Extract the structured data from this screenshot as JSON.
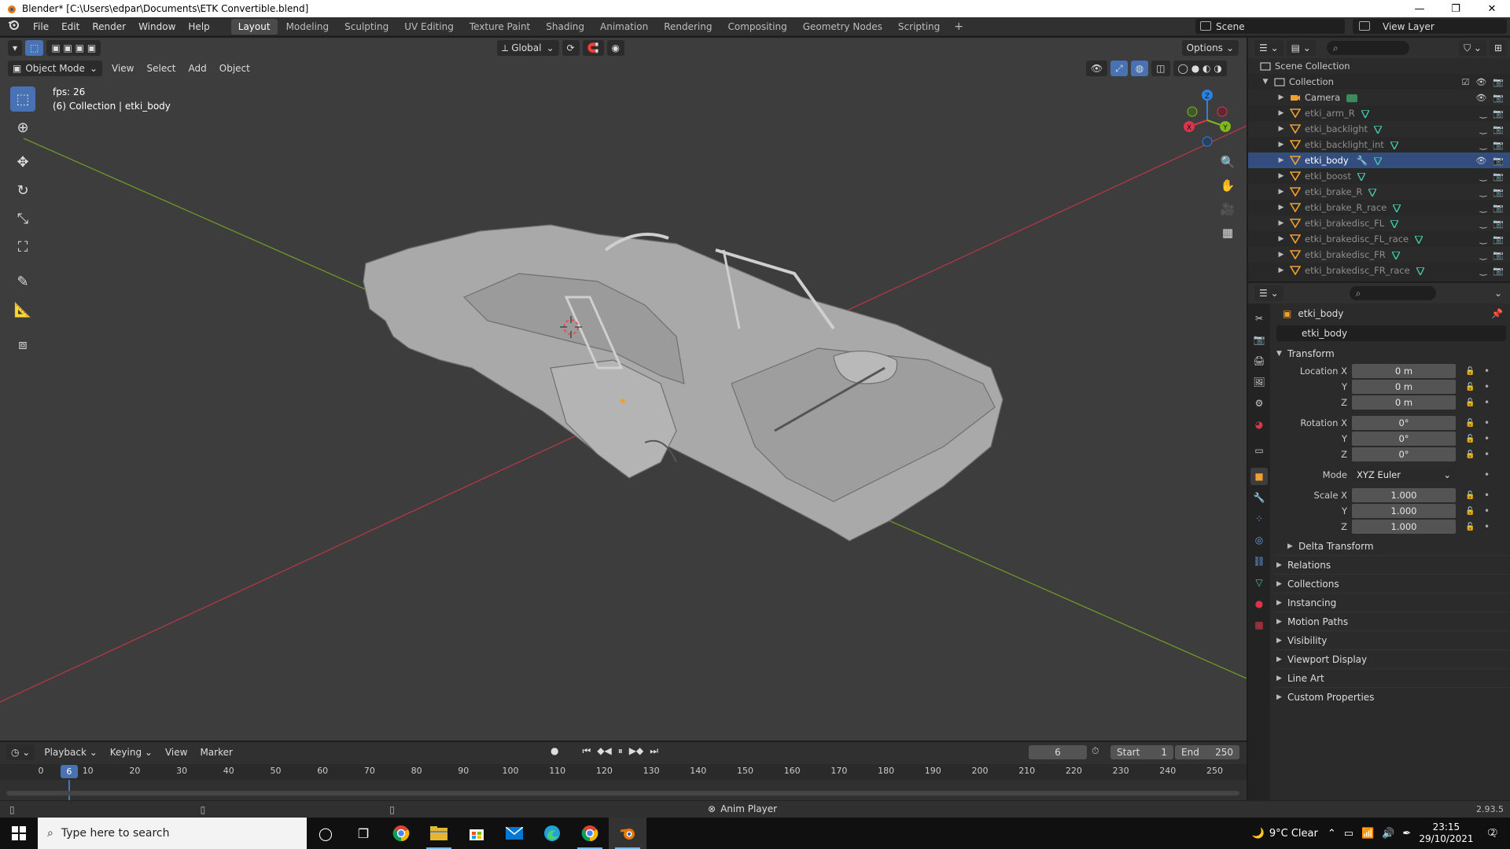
{
  "titlebar": {
    "title": "Blender* [C:\\Users\\edpar\\Documents\\ETK Convertible.blend]",
    "minimize": "—",
    "maximize": "❐",
    "close": "✕"
  },
  "menu": [
    "File",
    "Edit",
    "Render",
    "Window",
    "Help"
  ],
  "workspaces": [
    "Layout",
    "Modeling",
    "Sculpting",
    "UV Editing",
    "Texture Paint",
    "Shading",
    "Animation",
    "Rendering",
    "Compositing",
    "Geometry Nodes",
    "Scripting"
  ],
  "add_tab": "+",
  "scene": "Scene",
  "view_layer": "View Layer",
  "viewport": {
    "transform_orientation": "Global",
    "options": "Options",
    "mode": "Object Mode",
    "menus": [
      "View",
      "Select",
      "Add",
      "Object"
    ],
    "fps": "fps: 26",
    "collection_info": "(6) Collection | etki_body",
    "gizmo": {
      "x": "X",
      "y": "Y",
      "z": "Z"
    }
  },
  "outliner": {
    "scene_collection": "Scene Collection",
    "collection": "Collection",
    "items": [
      {
        "name": "Camera",
        "state": "normal"
      },
      {
        "name": "etki_arm_R",
        "state": "dim"
      },
      {
        "name": "etki_backlight",
        "state": "dim"
      },
      {
        "name": "etki_backlight_int",
        "state": "dim"
      },
      {
        "name": "etki_body",
        "state": "active"
      },
      {
        "name": "etki_boost",
        "state": "dim"
      },
      {
        "name": "etki_brake_R",
        "state": "dim"
      },
      {
        "name": "etki_brake_R_race",
        "state": "dim"
      },
      {
        "name": "etki_brakedisc_FL",
        "state": "dim"
      },
      {
        "name": "etki_brakedisc_FL_race",
        "state": "dim"
      },
      {
        "name": "etki_brakedisc_FR",
        "state": "dim"
      },
      {
        "name": "etki_brakedisc_FR_race",
        "state": "dim"
      }
    ]
  },
  "properties": {
    "object_name": "etki_body",
    "transform_title": "Transform",
    "location_label": "Location X",
    "rotation_label": "Rotation X",
    "scale_label": "Scale X",
    "y_label": "Y",
    "z_label": "Z",
    "mode_label": "Mode",
    "location": [
      "0 m",
      "0 m",
      "0 m"
    ],
    "rotation": [
      "0°",
      "0°",
      "0°"
    ],
    "mode": "XYZ Euler",
    "scale": [
      "1.000",
      "1.000",
      "1.000"
    ],
    "delta_transform": "Delta Transform",
    "panels": [
      "Relations",
      "Collections",
      "Instancing",
      "Motion Paths",
      "Visibility",
      "Viewport Display",
      "Line Art",
      "Custom Properties"
    ]
  },
  "timeline": {
    "menus": [
      "Playback",
      "Keying",
      "View",
      "Marker"
    ],
    "current_frame": "6",
    "start_label": "Start",
    "start": "1",
    "end_label": "End",
    "end": "250",
    "ticks": [
      "0",
      "10",
      "20",
      "30",
      "40",
      "50",
      "60",
      "70",
      "80",
      "90",
      "100",
      "110",
      "120",
      "130",
      "140",
      "150",
      "160",
      "170",
      "180",
      "190",
      "200",
      "210",
      "220",
      "230",
      "240",
      "250"
    ],
    "cursor_frame": "6"
  },
  "statusbar": {
    "anim_player": "Anim Player",
    "version": "2.93.5"
  },
  "taskbar": {
    "search_placeholder": "Type here to search",
    "weather": "9°C  Clear",
    "time": "23:15",
    "date": "29/10/2021",
    "notifications": "2"
  },
  "colors": {
    "accent": "#4772b3",
    "x_axis": "#d9364b",
    "y_axis": "#7fb71d",
    "z_axis": "#2a82e4",
    "viewport_bg": "#3d3d3d"
  }
}
